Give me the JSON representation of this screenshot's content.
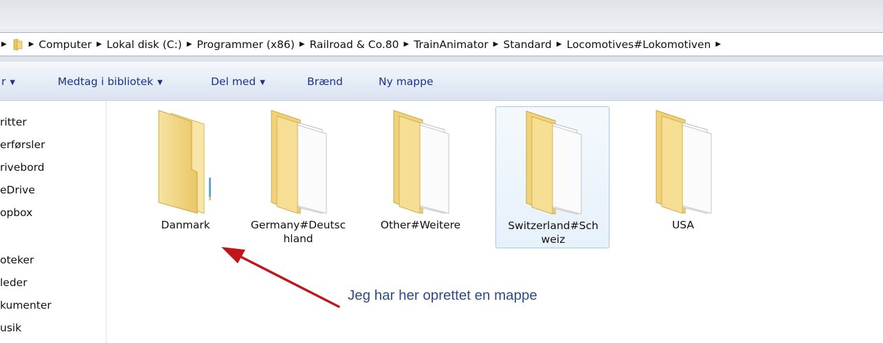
{
  "breadcrumb": {
    "items": [
      "Computer",
      "Lokal disk (C:)",
      "Programmer (x86)",
      "Railroad & Co.80",
      "TrainAnimator",
      "Standard",
      "Locomotives#Lokomotiven"
    ]
  },
  "toolbar": {
    "organize_fragment": "r",
    "include_library": "Medtag i bibliotek",
    "share_with": "Del med",
    "burn": "Brænd",
    "new_folder": "Ny mappe"
  },
  "navpane": {
    "items": [
      "ritter",
      "erførsler",
      "rivebord",
      "eDrive",
      "opbox",
      "oteker",
      "leder",
      "kumenter",
      "usik"
    ]
  },
  "folders": [
    {
      "name_line1": "Danmark",
      "name_line2": "",
      "kind": "empty",
      "selected": false
    },
    {
      "name_line1": "Germany#Deutsc",
      "name_line2": "hland",
      "kind": "full",
      "selected": false
    },
    {
      "name_line1": "Other#Weitere",
      "name_line2": "",
      "kind": "full",
      "selected": false
    },
    {
      "name_line1": "Switzerland#Sch",
      "name_line2": "weiz",
      "kind": "full",
      "selected": true
    },
    {
      "name_line1": "USA",
      "name_line2": "",
      "kind": "full",
      "selected": false
    }
  ],
  "annotation": {
    "text": "Jeg har her oprettet en mappe",
    "color": "#c0161b"
  },
  "icons": {
    "folder": "folder-icon",
    "breadcrumb_separator": "chevron-right-icon",
    "dropdown": "chevron-down-icon"
  }
}
